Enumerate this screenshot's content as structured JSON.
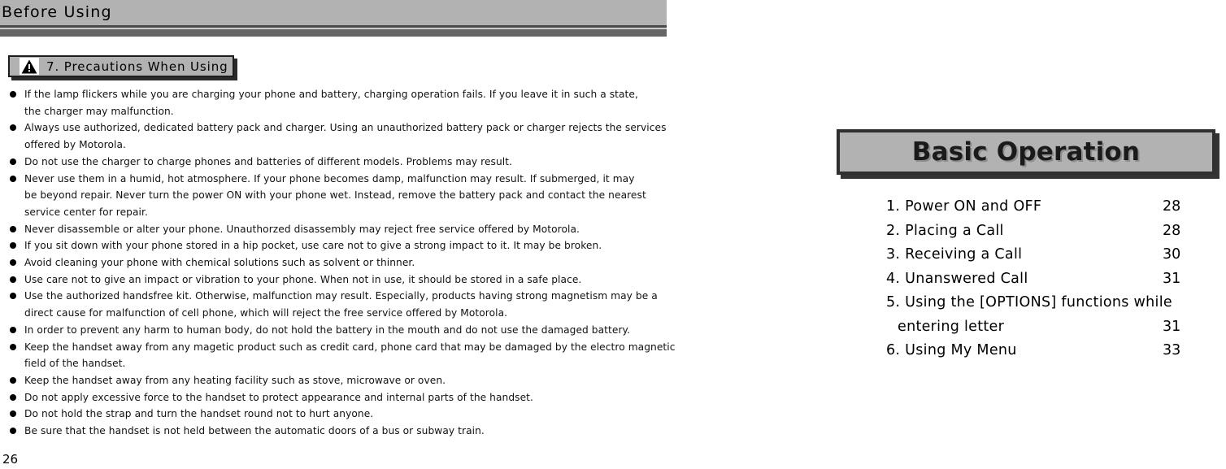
{
  "header": {
    "running_title": "Before Using"
  },
  "section": {
    "icon": "warning-triangle-icon",
    "label": "7. Precautions When Using"
  },
  "precautions": [
    [
      "If the lamp flickers while you are charging your phone and battery, charging operation fails. If you leave it in such a state,",
      "the charger may malfunction."
    ],
    [
      "Always use authorized, dedicated battery pack and charger. Using an unauthorized battery pack or charger rejects the services",
      "offered by Motorola."
    ],
    [
      "Do not use the charger to charge phones and batteries of different models. Problems may result."
    ],
    [
      "Never use them in a humid, hot atmosphere. If your phone becomes damp, malfunction may result. If submerged, it may",
      "be beyond repair. Never turn the power ON with your phone wet. Instead, remove the battery pack and contact the nearest",
      "service center for repair."
    ],
    [
      "Never disassemble or alter your phone. Unauthorzed disassembly may reject free service offered by Motorola."
    ],
    [
      "If you sit down with your phone stored in a hip pocket, use care not to give a strong impact to it. It may be broken."
    ],
    [
      "Avoid cleaning your phone with chemical solutions such as solvent or thinner."
    ],
    [
      "Use care not to give an impact or vibration to your phone. When not in use, it should be stored in a safe place."
    ],
    [
      "Use the authorized handsfree kit. Otherwise, malfunction may result. Especially, products having strong magnetism may be a",
      "direct cause for malfunction of cell phone, which will reject the free service offered by Motorola."
    ],
    [
      "In order to prevent any harm to human body, do not hold the battery in the mouth and do not use the damaged battery."
    ],
    [
      "Keep the handset away from any magetic product such as credit card, phone card that may be damaged by the electro magnetic",
      "field of the handset."
    ],
    [
      "Keep the handset away from any heating facility such as stove, microwave or oven."
    ],
    [
      "Do not apply excessive force to the handset to protect appearance and internal parts of the handset."
    ],
    [
      "Do not hold the strap and turn the handset round not to hurt anyone."
    ],
    [
      "Be sure that the handset is not held between the automatic doors of a bus or subway train."
    ]
  ],
  "page_number": "26",
  "chapter": {
    "title": "Basic Operation",
    "toc": [
      {
        "label": "1. Power ON and OFF",
        "page": "28",
        "indented": false
      },
      {
        "label": "2. Placing a Call",
        "page": "28",
        "indented": false
      },
      {
        "label": "3. Receiving a Call",
        "page": "30",
        "indented": false
      },
      {
        "label": "4. Unanswered Call",
        "page": "31",
        "indented": false
      },
      {
        "label": "5. Using the [OPTIONS] functions while",
        "page": "",
        "indented": false
      },
      {
        "label": "entering letter",
        "page": "31",
        "indented": true
      },
      {
        "label": "6. Using My Menu",
        "page": "33",
        "indented": false
      }
    ]
  },
  "colors": {
    "header_bar": "#b2b2b2",
    "rule_dark": "#666666",
    "chip_border": "#1e1e1e",
    "panel_border": "#303030",
    "text": "#000000"
  }
}
